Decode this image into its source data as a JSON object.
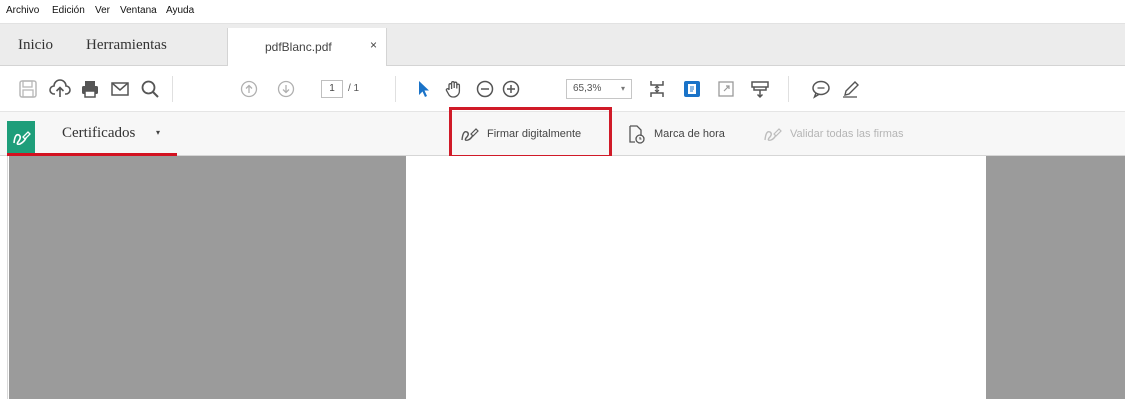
{
  "menu": {
    "items": [
      "Archivo",
      "Edición",
      "Ver",
      "Ventana",
      "Ayuda"
    ]
  },
  "tabs": {
    "home": "Inicio",
    "tools": "Herramientas",
    "document": "pdfBlanc.pdf",
    "close_glyph": "×"
  },
  "toolbar": {
    "icons": [
      "save-icon",
      "upload-cloud-icon",
      "print-icon",
      "email-icon",
      "search-icon",
      "page-up-icon",
      "page-down-icon",
      "select-arrow-icon",
      "hand-icon",
      "zoom-out-icon",
      "zoom-in-icon",
      "fit-page-icon",
      "scrolling-mode-icon",
      "full-screen-icon",
      "highlight-tool-icon",
      "comment-icon",
      "pen-icon"
    ],
    "page_current": "1",
    "page_total": "/ 1",
    "zoom": "65,3%",
    "zoom_caret": "▾"
  },
  "certificates": {
    "title": "Certificados",
    "caret": "▾",
    "sign_digitally": "Firmar digitalmente",
    "timestamp": "Marca de hora",
    "validate_all": "Validar todas las firmas"
  },
  "colors": {
    "accent_green": "#1e9e7a",
    "highlight_red": "#d01a28",
    "select_blue": "#1a73c8",
    "doc_gray": "#9b9b9b"
  }
}
